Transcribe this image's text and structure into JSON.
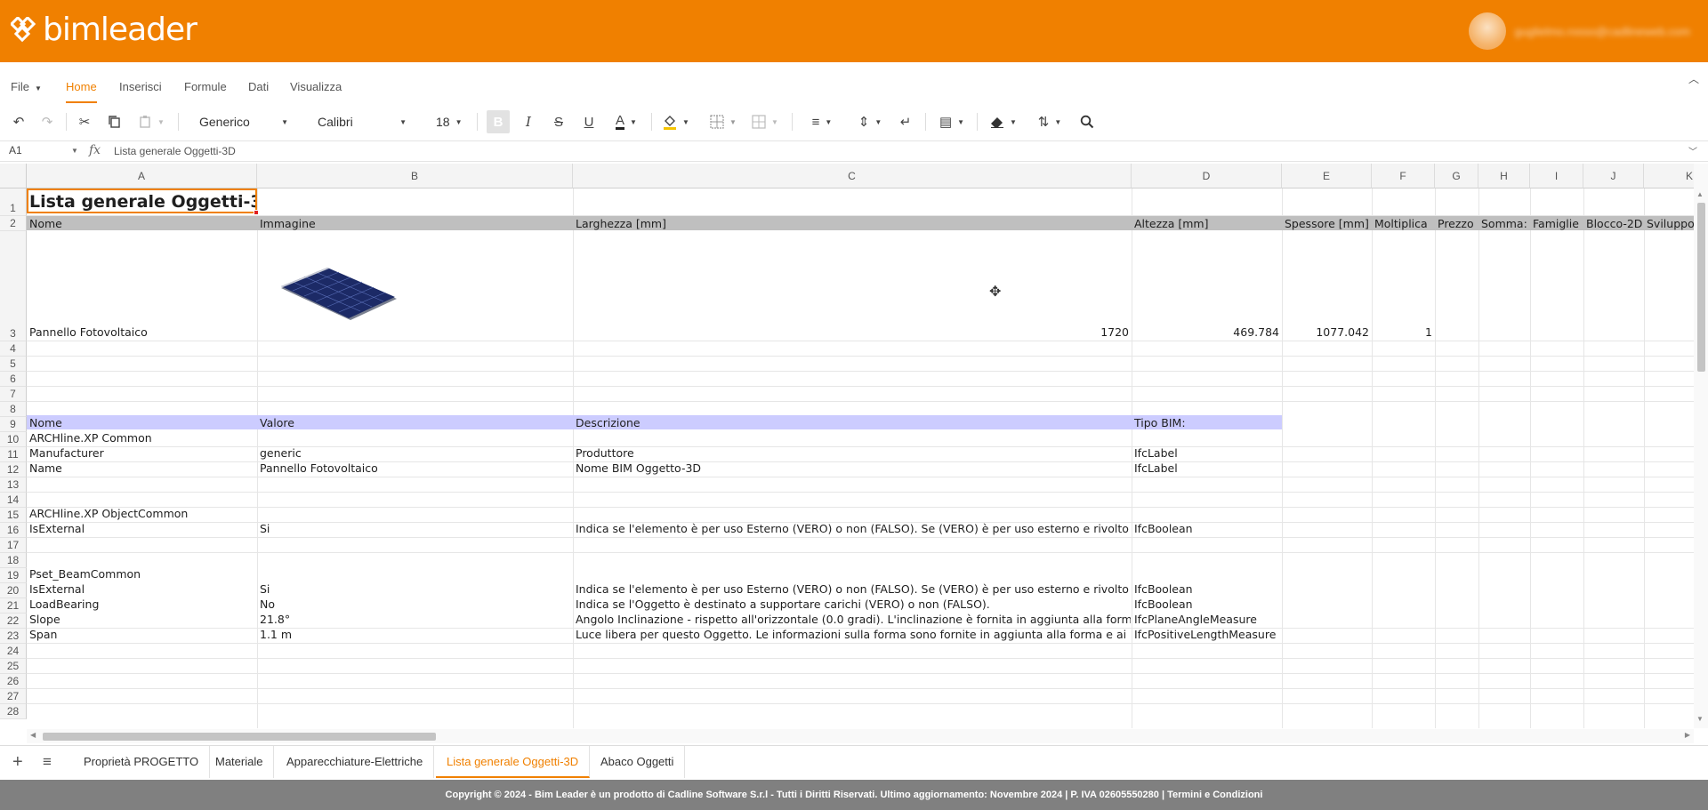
{
  "brand": {
    "logo_text": "bimleader",
    "user_email": "guglielmo.rosso@cadlineweb.com"
  },
  "menu": {
    "file": "File",
    "tabs": [
      "Home",
      "Inserisci",
      "Formule",
      "Dati",
      "Visualizza"
    ],
    "active_tab": "Home"
  },
  "toolbar": {
    "number_format": "Generico",
    "font_family": "Calibri",
    "font_size": "18",
    "bold_label": "B",
    "italic_label": "I",
    "strike_label": "S",
    "underline_label": "U",
    "font_color_label": "A"
  },
  "formula_bar": {
    "cell_ref": "A1",
    "fx": "fx",
    "content": "Lista generale Oggetti-3D"
  },
  "columns": [
    "A",
    "B",
    "C",
    "D",
    "E",
    "F",
    "G",
    "H",
    "I",
    "J",
    "K"
  ],
  "rows": [
    "1",
    "2",
    "3",
    "4",
    "5",
    "6",
    "7",
    "8",
    "9",
    "10",
    "11",
    "12",
    "13",
    "14",
    "15",
    "16",
    "17",
    "18",
    "19",
    "20",
    "21",
    "22",
    "23",
    "24",
    "25",
    "26",
    "27",
    "28"
  ],
  "sheet": {
    "title": "Lista generale Oggetti-3D",
    "header_row": [
      "Nome",
      "Immagine",
      "Larghezza [mm]",
      "Altezza [mm]",
      "Spessore [mm]",
      "Moltiplica",
      "Prezzo",
      "Somma:",
      "Famiglie",
      "Blocco-2D",
      "Sviluppo"
    ],
    "object": {
      "name": "Pannello Fotovoltaico",
      "larghezza": "1720",
      "altezza": "469.784",
      "spessore": "1077.042",
      "moltiplica": "1"
    },
    "prop_header": [
      "Nome",
      "Valore",
      "Descrizione",
      "Tipo BIM:"
    ],
    "groups": {
      "common": "ARCHline.XP Common",
      "objectcommon": "ARCHline.XP ObjectCommon",
      "beam": "Pset_BeamCommon"
    },
    "props": {
      "r10": [
        "Manufacturer",
        "generic",
        "Produttore",
        "IfcLabel"
      ],
      "r11": [
        "Name",
        "Pannello Fotovoltaico",
        "Nome BIM Oggetto-3D",
        "IfcLabel"
      ],
      "r15": [
        "IsExternal",
        "Si",
        "Indica se l'elemento è per uso Esterno (VERO) o non (FALSO). Se (VERO) è per uso esterno e rivolto verso l'esterno dell'edificio.",
        "IfcBoolean"
      ],
      "r19": [
        "IsExternal",
        "Si",
        "Indica se l'elemento è per uso Esterno (VERO) o non (FALSO). Se (VERO) è per uso esterno e rivolto verso l'esterno dell'edificio.",
        "IfcBoolean"
      ],
      "r20": [
        "LoadBearing",
        "No",
        "Indica se l'Oggetto è destinato a supportare carichi (VERO) o non (FALSO).",
        "IfcBoolean"
      ],
      "r21": [
        "Slope",
        "21.8°",
        "Angolo Inclinazione - rispetto all'orizzontale (0.0 gradi). L'inclinazione è fornita in aggiunta alla forma e ai parametri geometrici.",
        "IfcPlaneAngleMeasure"
      ],
      "r22": [
        "Span",
        "1.1 m",
        "Luce libera per questo Oggetto. Le informazioni sulla forma sono fornite in aggiunta alla forma e ai parametri geometrici.",
        "IfcPositiveLengthMeasure"
      ]
    }
  },
  "sheet_tabs": [
    "Proprietà PROGETTO",
    "Materiale",
    "Apparecchiature-Elettriche",
    "Lista generale Oggetti-3D",
    "Abaco Oggetti"
  ],
  "active_sheet": "Lista generale Oggetti-3D",
  "footer": "Copyright © 2024 - Bim Leader è un prodotto di Cadline Software S.r.l - Tutti i Diritti Riservati. Ultimo aggiornamento: Novembre 2024 | P. IVA 02605550280 | Termini e Condizioni",
  "colors": {
    "brand": "#f08000",
    "header_band": "#bfbfbf",
    "prop_band": "#ccccff",
    "footer": "#808080"
  }
}
